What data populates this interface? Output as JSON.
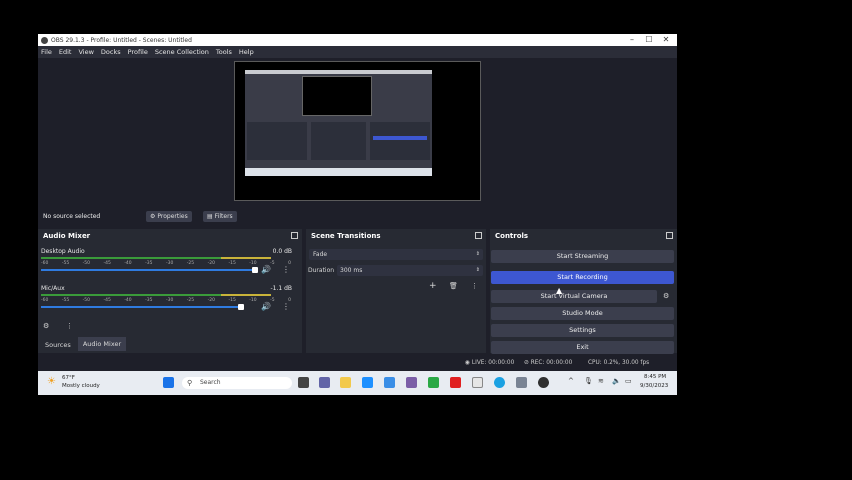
{
  "window": {
    "title": "OBS 29.1.3 - Profile: Untitled - Scenes: Untitled",
    "min": "–",
    "max": "☐",
    "close": "✕"
  },
  "menu": [
    "File",
    "Edit",
    "View",
    "Docks",
    "Profile",
    "Scene Collection",
    "Tools",
    "Help"
  ],
  "source_bar": {
    "status": "No source selected",
    "properties": "Properties",
    "filters": "Filters"
  },
  "audio_mixer": {
    "title": "Audio Mixer",
    "channels": [
      {
        "name": "Desktop Audio",
        "db": "0.0 dB"
      },
      {
        "name": "Mic/Aux",
        "db": "-1.1 dB"
      }
    ],
    "scale": [
      "-60",
      "-55",
      "-50",
      "-45",
      "-40",
      "-35",
      "-30",
      "-25",
      "-20",
      "-15",
      "-10",
      "-5",
      "0"
    ],
    "tabs": [
      "Sources",
      "Audio Mixer"
    ]
  },
  "scene_transitions": {
    "title": "Scene Transitions",
    "transition": "Fade",
    "duration_label": "Duration",
    "duration_value": "300 ms"
  },
  "controls": {
    "title": "Controls",
    "buttons": [
      "Start Streaming",
      "Start Recording",
      "Start Virtual Camera",
      "Studio Mode",
      "Settings",
      "Exit"
    ]
  },
  "status": {
    "live": "LIVE: 00:00:00",
    "rec": "REC: 00:00:00",
    "cpu": "CPU: 0.2%, 30.00 fps"
  },
  "taskbar": {
    "temp": "67°F",
    "weather": "Mostly cloudy",
    "search": "Search",
    "time": "8:45 PM",
    "date": "9/30/2023"
  },
  "colors": {
    "accent": "#3d57d1",
    "panel": "#272a33",
    "bg": "#1e1f29"
  }
}
